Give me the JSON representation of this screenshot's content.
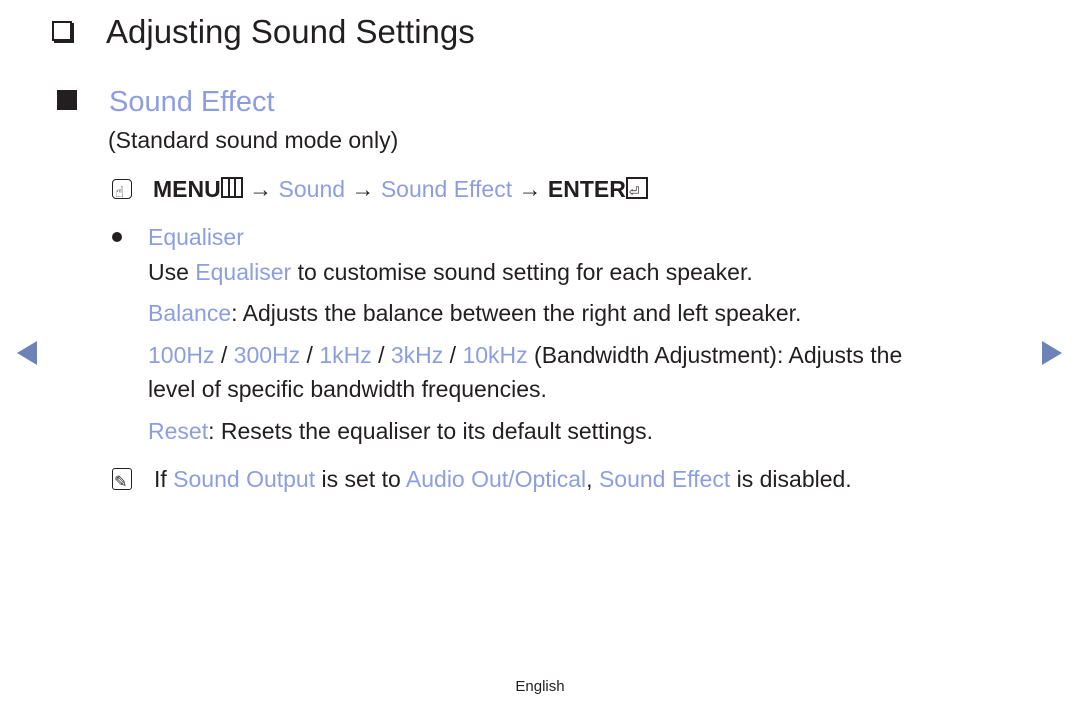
{
  "heading": {
    "title": "Adjusting Sound Settings",
    "icon": "checkbox-icon"
  },
  "section": {
    "title": "Sound Effect",
    "note": "(Standard sound mode only)"
  },
  "menu_path": {
    "icon": "remote-touch-icon",
    "menu_label": "MENU",
    "menu_icon": "menu-grid-icon",
    "arrow": "→",
    "step1": "Sound",
    "step2": "Sound Effect",
    "enter_label": "ENTER",
    "enter_icon": "enter-icon"
  },
  "equaliser": {
    "title": "Equaliser",
    "line1": {
      "pre": "Use ",
      "link": "Equaliser",
      "post": " to customise sound setting for each speaker."
    },
    "balance": {
      "link": "Balance",
      "text": ": Adjusts the balance between the right and left speaker."
    },
    "bands": {
      "items": [
        "100Hz",
        "300Hz",
        "1kHz",
        "3kHz",
        "10kHz"
      ],
      "separator": " / ",
      "text": " (Bandwidth Adjustment): Adjusts the",
      "text2": "level of specific bandwidth frequencies."
    },
    "reset": {
      "link": "Reset",
      "text": ": Resets the equaliser to its default settings."
    }
  },
  "note": {
    "icon": "note-icon",
    "pre": "If ",
    "link1": "Sound Output",
    "mid1": " is set to ",
    "link2": "Audio Out/Optical",
    "mid2": ", ",
    "link3": "Sound Effect",
    "post": " is disabled."
  },
  "navigation": {
    "prev": "previous-page",
    "next": "next-page"
  },
  "footer": {
    "language": "English"
  },
  "colors": {
    "link": "#8c9ee0",
    "text": "#231f20",
    "nav_arrow": "#6d82b6"
  }
}
